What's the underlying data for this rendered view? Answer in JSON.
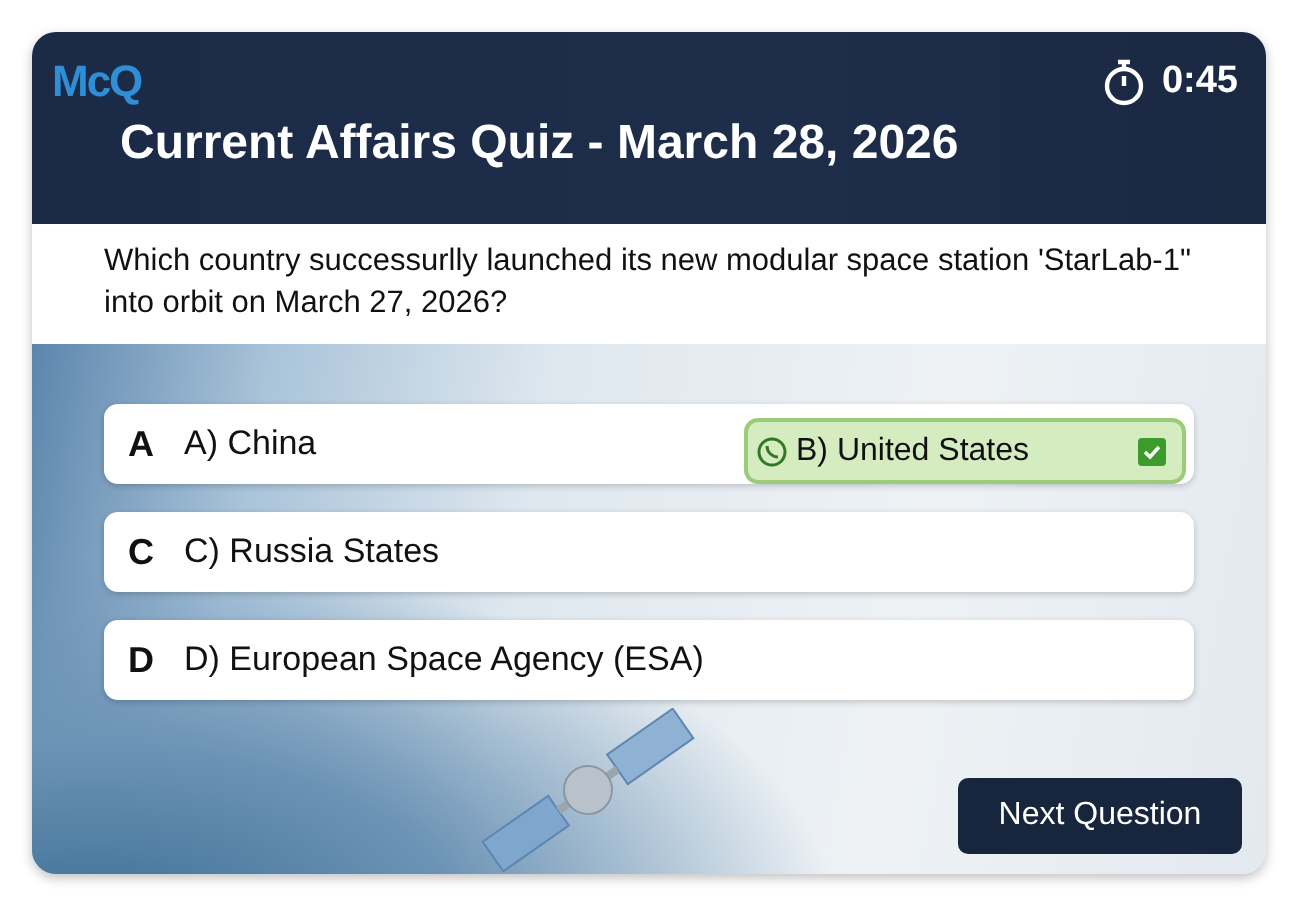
{
  "header": {
    "logo": "McQ",
    "timer": "0:45",
    "title": "Current Affairs Quiz - March 28, 2026"
  },
  "question": "Which country successurlly launched its new modular space station 'StarLab-1\" into orbit on March 27, 2026?",
  "options": [
    {
      "letter": "A",
      "label": "A) China",
      "selected": false,
      "chip": {
        "label": "B) United States",
        "selected": true
      }
    },
    {
      "letter": "C",
      "label": "C) Russia States",
      "selected": false
    },
    {
      "letter": "D",
      "label": "D) European Space Agency (ESA)",
      "selected": false
    }
  ],
  "next_button": "Next Question"
}
